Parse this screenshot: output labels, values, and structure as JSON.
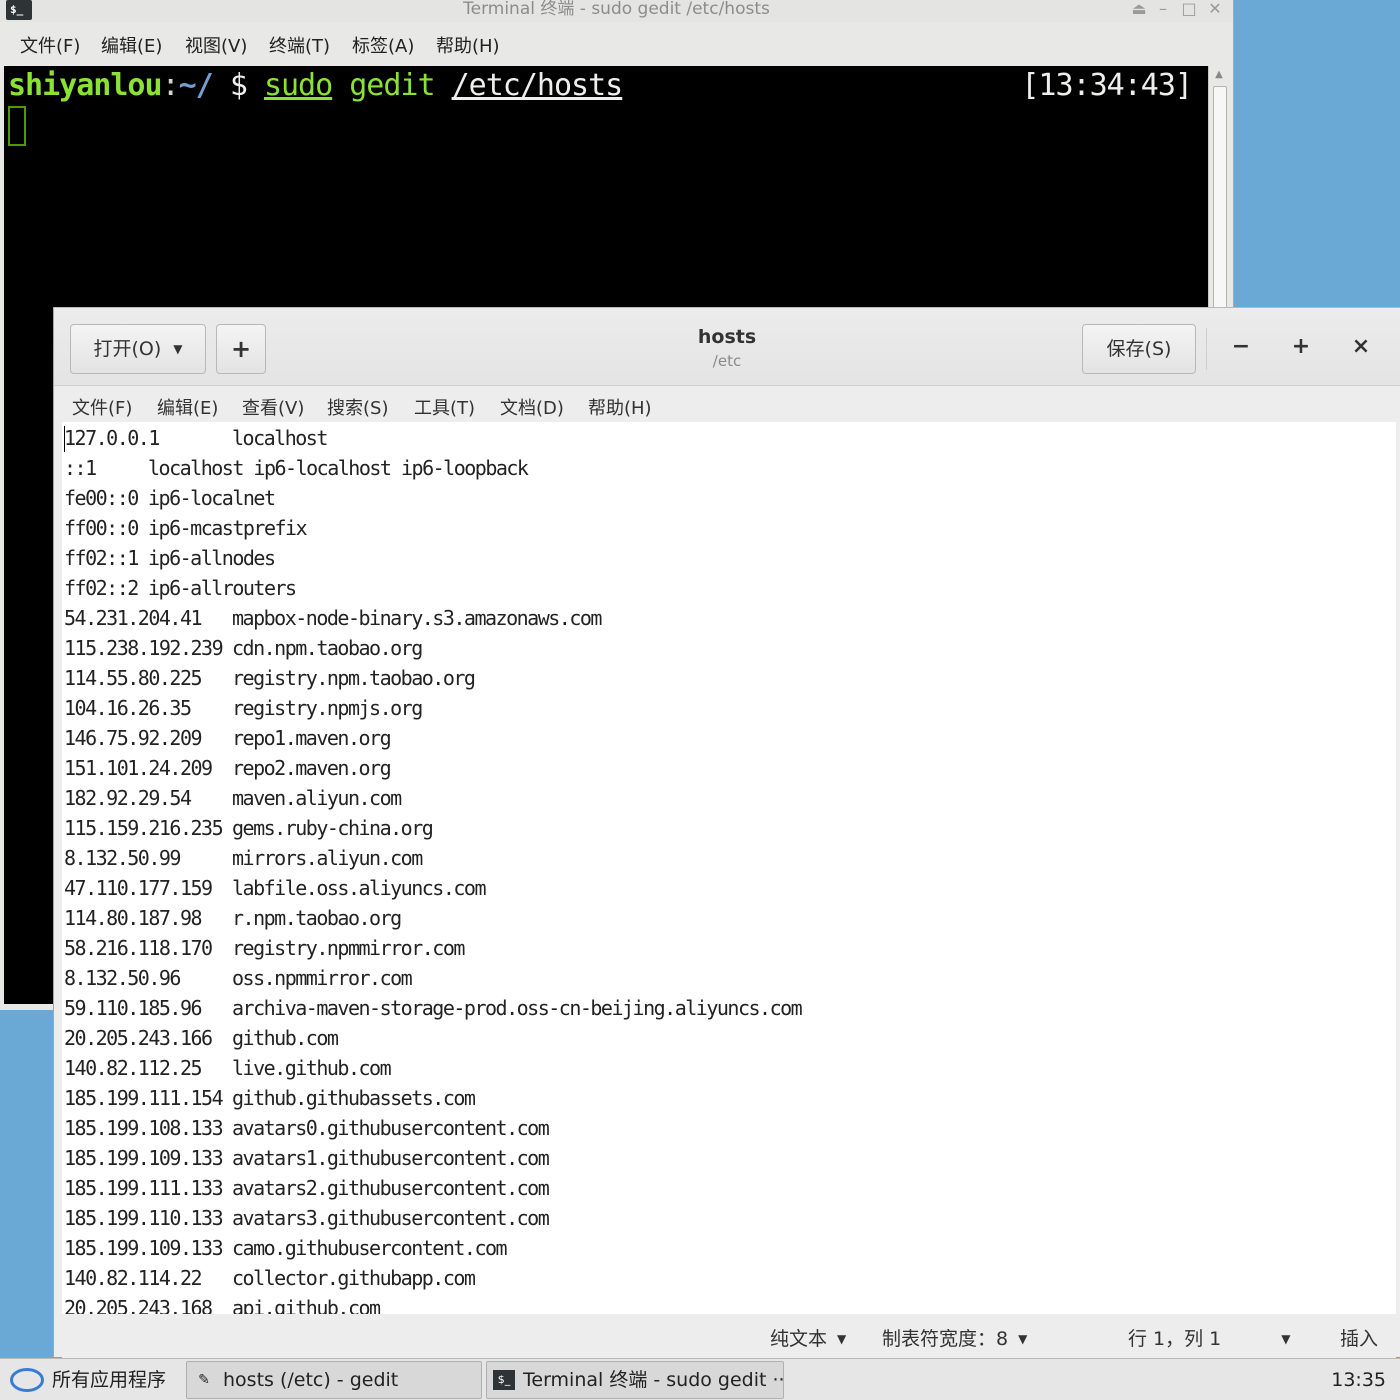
{
  "terminal": {
    "title": "Terminal 终端 - sudo gedit /etc/hosts",
    "menu": [
      "文件(F)",
      "编辑(E)",
      "视图(V)",
      "终端(T)",
      "标签(A)",
      "帮助(H)"
    ],
    "prompt_user": "shiyanlou",
    "prompt_colon": ":",
    "prompt_path": "~/",
    "prompt_symbol": "$",
    "cmd_sudo": "sudo",
    "cmd_name": "gedit",
    "cmd_arg": "/etc/hosts",
    "time": "[13:34:43]",
    "icons": {
      "app": "terminal-icon",
      "buttons": [
        "eject-icon",
        "minimize-icon",
        "maximize-icon",
        "close-icon"
      ]
    }
  },
  "gedit": {
    "open_label": "打开(O)",
    "new_tab_label": "+",
    "title": "hosts",
    "subtitle": "/etc",
    "save_label": "保存(S)",
    "minimize_label": "−",
    "maximize_label": "+",
    "close_label": "×",
    "menu": [
      "文件(F)",
      "编辑(E)",
      "查看(V)",
      "搜索(S)",
      "工具(T)",
      "文档(D)",
      "帮助(H)"
    ],
    "lines": [
      [
        "127.0.0.1",
        "localhost"
      ],
      [
        "::1",
        "localhost ip6-localhost ip6-loopback"
      ],
      [
        "fe00::0",
        "ip6-localnet"
      ],
      [
        "ff00::0",
        "ip6-mcastprefix"
      ],
      [
        "ff02::1",
        "ip6-allnodes"
      ],
      [
        "ff02::2",
        "ip6-allrouters"
      ],
      [
        "54.231.204.41",
        "mapbox-node-binary.s3.amazonaws.com"
      ],
      [
        "115.238.192.239",
        "cdn.npm.taobao.org"
      ],
      [
        "114.55.80.225",
        "registry.npm.taobao.org"
      ],
      [
        "104.16.26.35",
        "registry.npmjs.org"
      ],
      [
        "146.75.92.209",
        "repo1.maven.org"
      ],
      [
        "151.101.24.209",
        "repo2.maven.org"
      ],
      [
        "182.92.29.54",
        "maven.aliyun.com"
      ],
      [
        "115.159.216.235",
        "gems.ruby-china.org"
      ],
      [
        "8.132.50.99",
        "mirrors.aliyun.com"
      ],
      [
        "47.110.177.159",
        "labfile.oss.aliyuncs.com"
      ],
      [
        "114.80.187.98",
        "r.npm.taobao.org"
      ],
      [
        "58.216.118.170",
        "registry.npmmirror.com"
      ],
      [
        "8.132.50.96",
        "oss.npmmirror.com"
      ],
      [
        "59.110.185.96",
        "archiva-maven-storage-prod.oss-cn-beijing.aliyuncs.com"
      ],
      [
        "20.205.243.166",
        "github.com"
      ],
      [
        "140.82.112.25",
        "live.github.com"
      ],
      [
        "185.199.111.154",
        "github.githubassets.com"
      ],
      [
        "185.199.108.133",
        "avatars0.githubusercontent.com"
      ],
      [
        "185.199.109.133",
        "avatars1.githubusercontent.com"
      ],
      [
        "185.199.111.133",
        "avatars2.githubusercontent.com"
      ],
      [
        "185.199.110.133",
        "avatars3.githubusercontent.com"
      ],
      [
        "185.199.109.133",
        "camo.githubusercontent.com"
      ],
      [
        "140.82.114.22",
        "collector.githubapp.com"
      ],
      [
        "20.205.243.168",
        "api.github.com"
      ]
    ],
    "status": {
      "language": "纯文本",
      "tab_width": "制表符宽度：8",
      "position": "行 1，列 1",
      "mode": "插入"
    }
  },
  "taskbar": {
    "apps_label": "所有应用程序",
    "tasks": [
      {
        "label": "hosts (/etc) - gedit",
        "icon": "text-editor-icon"
      },
      {
        "label": "Terminal 终端 - sudo gedit ···",
        "icon": "terminal-icon"
      }
    ],
    "clock": "13:35"
  },
  "colors": {
    "desktop": "#6aa9d6",
    "terminal_bg": "#000000",
    "prompt_green": "#8ae234",
    "prompt_blue": "#729fcf"
  }
}
